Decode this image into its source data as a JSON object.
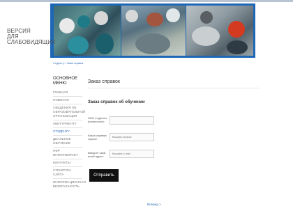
{
  "header": {
    "version_lines": [
      "ВЕРСИЯ",
      "ДЛЯ",
      "СЛАБОВИДЯЩИХ"
    ]
  },
  "breadcrumb": "Студенту > Заказ справок",
  "sidebar": {
    "title_lines": [
      "ОСНОВНОЕ",
      "МЕНЮ"
    ],
    "items": [
      {
        "label": "ГЛАВНАЯ"
      },
      {
        "label": "НОВОСТИ"
      },
      {
        "label": "СВЕДЕНИЯ ОБ\nОБРАЗОВАТЕЛЬНОЙ\nОРГАНИЗАЦИИ"
      },
      {
        "label": "АБИТУРИЕНТУ"
      },
      {
        "label": "СТУДЕНТУ"
      },
      {
        "label": "ДИАЛЬНОЕ\nОБУЧЕНИЕ"
      },
      {
        "label": "ПФР\nИНФОРМИРУЕТ"
      },
      {
        "label": "КОНТАКТЫ"
      },
      {
        "label": "СТРУКТУРА\nСАЙТА"
      },
      {
        "label": "ИНФОРМАЦИОННАЯ\nБЕЗОПАСНОСТЬ"
      }
    ]
  },
  "main": {
    "title": "Заказ справок",
    "form_title": "Заказ справок об обучении",
    "fields": [
      {
        "label_lines": [
          "ФИО студента",
          "(полностью):"
        ],
        "value": "",
        "placeholder": ""
      },
      {
        "label_lines": [
          "Какая справка",
          "нужна?"
        ],
        "value": "",
        "placeholder": "Ваш(ие) вопрос"
      },
      {
        "label_lines": [
          "Введите свой",
          "email адрес:"
        ],
        "value": "",
        "placeholder": "Ваш(ие) e-mail"
      }
    ],
    "submit_label": "Отправить",
    "back_link": "Вперед >"
  }
}
